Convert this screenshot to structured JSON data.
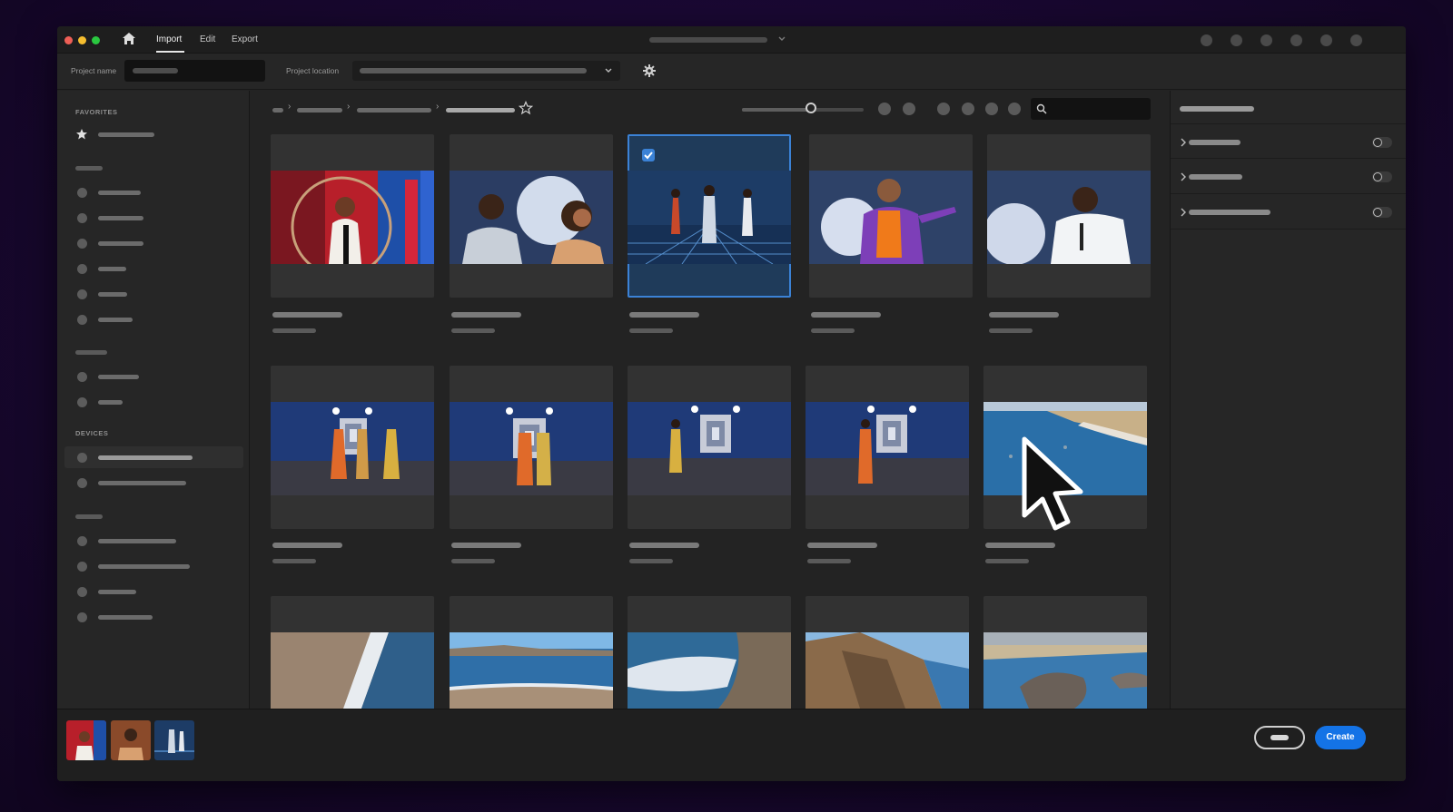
{
  "menu": {
    "import": "Import",
    "edit": "Edit",
    "export": "Export"
  },
  "toolbar": {
    "project_name_label": "Project name",
    "project_location_label": "Project location"
  },
  "sidebar": {
    "favorites_heading": "FAVORITES",
    "devices_heading": "DEVICES"
  },
  "footer": {
    "create_label": "Create"
  },
  "colors": {
    "accent": "#1473e6",
    "selection": "#3b82d6",
    "background": "#1a0833"
  },
  "icons": [
    "home-icon",
    "chevron-down-icon",
    "gear-icon",
    "star-icon",
    "search-icon",
    "chevron-right-icon",
    "checkbox-icon",
    "cursor-arrow-icon"
  ],
  "grid": {
    "columns": 5,
    "visible_rows": 3,
    "selected_item": 3
  }
}
